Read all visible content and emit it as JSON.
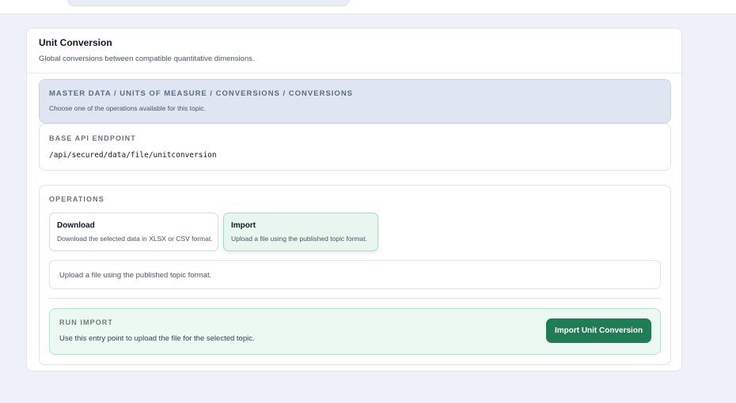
{
  "card": {
    "title": "Unit Conversion",
    "subtitle": "Global conversions between compatible quantitative dimensions."
  },
  "breadcrumb": {
    "path": "MASTER DATA / UNITS OF MEASURE / CONVERSIONS / CONVERSIONS",
    "subtitle": "Choose one of the operations available for this topic."
  },
  "endpoint": {
    "label": "BASE API ENDPOINT",
    "path": "/api/secured/data/file/unitconversion"
  },
  "operations": {
    "label": "OPERATIONS",
    "items": [
      {
        "title": "Download",
        "description": "Download the selected data in XLSX or CSV format."
      },
      {
        "title": "Import",
        "description": "Upload a file using the published topic format."
      }
    ],
    "selected": "Import",
    "selected_description": "Upload a file using the published topic format."
  },
  "run": {
    "label": "RUN IMPORT",
    "description": "Use this entry point to upload the file for the selected topic.",
    "button_label": "Import Unit Conversion"
  },
  "colors": {
    "accent": "#1f7d55",
    "accent_light": "#e8f6ef",
    "breadcrumb_bg": "#dfe6f2",
    "page_bg": "#eef1f8"
  }
}
